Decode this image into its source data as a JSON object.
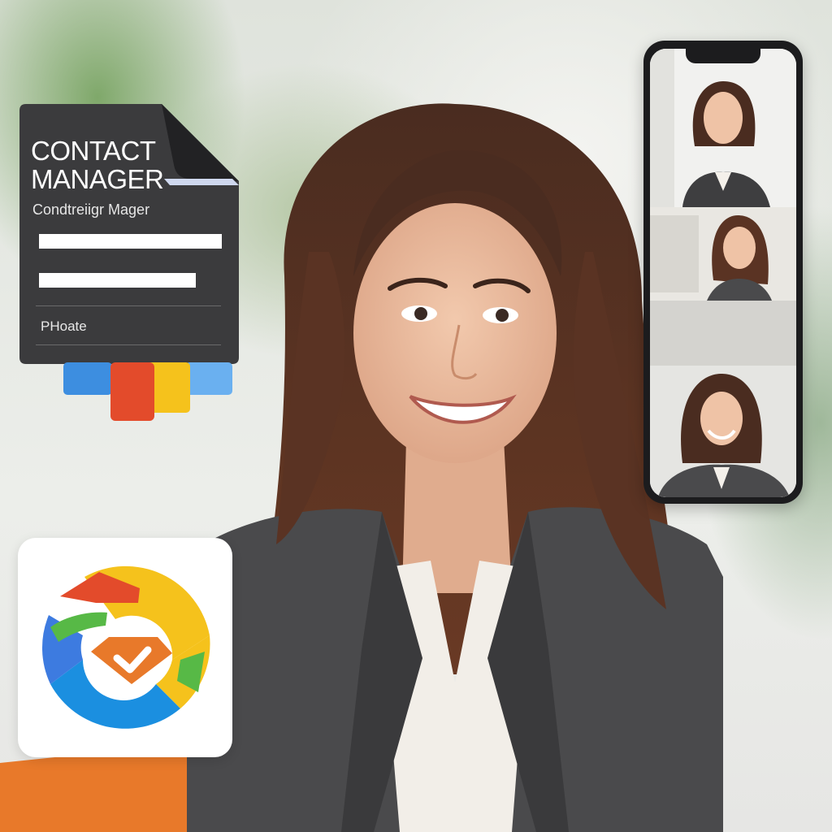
{
  "contact_card": {
    "title": "CONTACT\nMANAGER",
    "subtitle": "Condtreiigr Mager",
    "label": "PHoate"
  },
  "phone": {
    "photos": [
      "contact-photo-1",
      "contact-photo-2",
      "contact-photo-3"
    ]
  },
  "colors": {
    "card_bg": "#3b3b3d",
    "accent_orange": "#e8792a",
    "blue": "#3d8ee0",
    "red": "#e34b2b",
    "yellow": "#f5c21c",
    "green": "#57b946"
  }
}
